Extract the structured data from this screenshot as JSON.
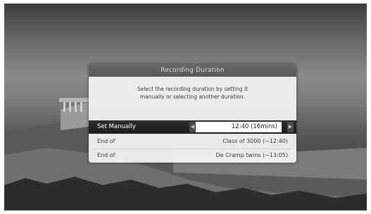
{
  "dialog": {
    "title": "Recording Duration",
    "message_line1": "Select the recording duration by setting it",
    "message_line2": "manually or selecting another duration.",
    "options": [
      {
        "label": "Set Manually",
        "value": "12:40 (16mins)",
        "selected": true
      },
      {
        "label": "End of",
        "value": "Class of 3000 (~12:40)",
        "selected": false
      },
      {
        "label": "End of",
        "value": "De Cramp twins (~13:05)",
        "selected": false
      }
    ],
    "left_arrow": "◀",
    "right_arrow": "▶"
  },
  "colors": {
    "title_bar": "#5f5f5f",
    "dialog_body": "#f0f0f0",
    "selected_row": "#262626",
    "value_box": "#ffffff"
  }
}
